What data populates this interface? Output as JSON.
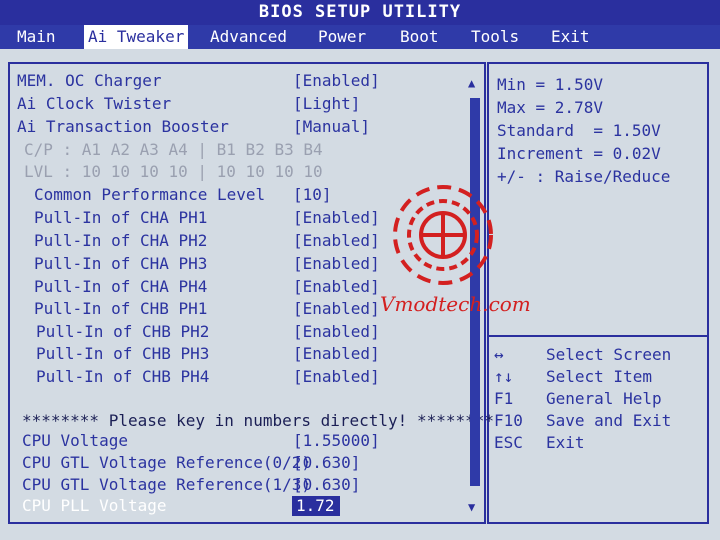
{
  "title": "BIOS SETUP UTILITY",
  "menu": [
    {
      "label": "Main",
      "active": false
    },
    {
      "label": "Ai Tweaker",
      "active": true
    },
    {
      "label": "Advanced",
      "active": false
    },
    {
      "label": "Power",
      "active": false
    },
    {
      "label": "Boot",
      "active": false
    },
    {
      "label": "Tools",
      "active": false
    },
    {
      "label": "Exit",
      "active": false
    }
  ],
  "settings": [
    {
      "label": "MEM. OC Charger",
      "value": "[Enabled]",
      "style": "normal"
    },
    {
      "label": "Ai Clock Twister",
      "value": "[Light]",
      "style": "normal"
    },
    {
      "label": "Ai Transaction Booster",
      "value": "[Manual]",
      "style": "normal"
    },
    {
      "label": "C/P : A1 A2 A3 A4 | B1 B2 B3 B4",
      "value": "",
      "style": "gray"
    },
    {
      "label": "LVL : 10 10 10 10 | 10 10 10 10",
      "value": "",
      "style": "gray"
    },
    {
      "label": "Common Performance Level",
      "value": "[10]",
      "style": "normal",
      "indent": true
    },
    {
      "label": "Pull-In of CHA PH1",
      "value": "[Enabled]",
      "style": "normal",
      "indent": true
    },
    {
      "label": "Pull-In of CHA PH2",
      "value": "[Enabled]",
      "style": "normal",
      "indent": true
    },
    {
      "label": "Pull-In of CHA PH3",
      "value": "[Enabled]",
      "style": "normal",
      "indent": true
    },
    {
      "label": "Pull-In of CHA PH4",
      "value": "[Enabled]",
      "style": "normal",
      "indent": true
    },
    {
      "label": "Pull-In of CHB PH1",
      "value": "[Enabled]",
      "style": "normal",
      "indent": true
    },
    {
      "label": "Pull-In of CHB PH2",
      "value": "[Enabled]",
      "style": "normal",
      "indent": true
    },
    {
      "label": "Pull-In of CHB PH3",
      "value": "[Enabled]",
      "style": "normal",
      "indent": true
    },
    {
      "label": "Pull-In of CHB PH4",
      "value": "[Enabled]",
      "style": "normal",
      "indent": true
    }
  ],
  "notice": "******** Please key in numbers directly! ********",
  "voltages": [
    {
      "label": "CPU Voltage",
      "value": "[1.55000]",
      "selected": false
    },
    {
      "label": "CPU GTL Voltage Reference(0/2)",
      "value": "[0.630]",
      "selected": false
    },
    {
      "label": "CPU GTL Voltage Reference(1/3)",
      "value": "[0.630]",
      "selected": false
    },
    {
      "label": "CPU PLL Voltage",
      "value": "1.72",
      "selected": true
    }
  ],
  "help": [
    "Min = 1.50V",
    "Max = 2.78V",
    "Standard  = 1.50V",
    "Increment = 0.02V",
    "+/- : Raise/Reduce"
  ],
  "keys": [
    {
      "key": "↔",
      "desc": "Select Screen"
    },
    {
      "key": "↑↓",
      "desc": "Select Item"
    },
    {
      "key": "F1",
      "desc": "General Help"
    },
    {
      "key": "F10",
      "desc": "Save and Exit"
    },
    {
      "key": "ESC",
      "desc": "Exit"
    }
  ],
  "watermark": "Vmodtech.com",
  "colors": {
    "bios_blue": "#2a2f9e",
    "screen_bg": "#d3dbe3",
    "watermark_red": "#d32020"
  }
}
